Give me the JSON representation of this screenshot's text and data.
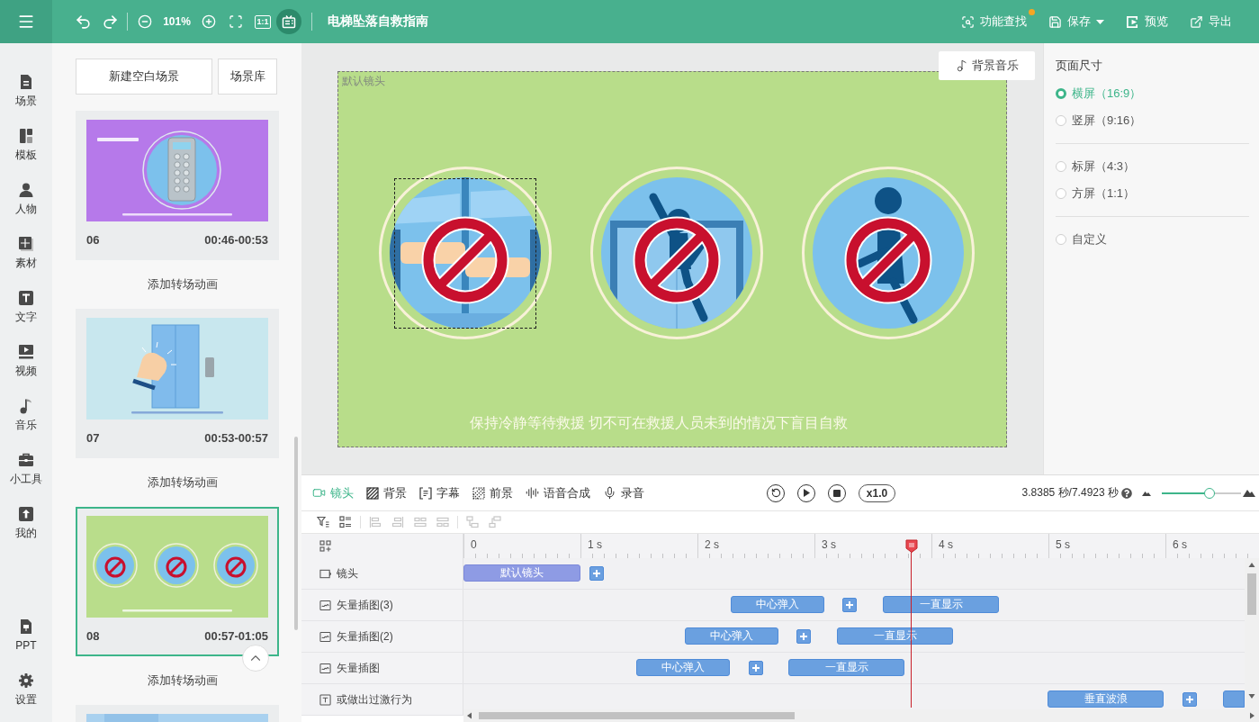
{
  "toolbar": {
    "zoom_level": "101%",
    "actual_size": "1:1",
    "captions_tool": {
      "selected": true
    },
    "title": "电梯坠落自救指南"
  },
  "toolbar_actions": [
    {
      "kind": "search",
      "label": "功能查找",
      "badge": true,
      "dropdown": false
    },
    {
      "kind": "save",
      "label": "保存",
      "badge": false,
      "dropdown": true
    },
    {
      "kind": "preview",
      "label": "预览",
      "badge": false,
      "dropdown": false
    },
    {
      "kind": "export",
      "label": "导出",
      "badge": false,
      "dropdown": false
    }
  ],
  "sidebar": {
    "items": [
      {
        "kind": "scene",
        "label": "场景"
      },
      {
        "kind": "template",
        "label": "模板"
      },
      {
        "kind": "person",
        "label": "人物"
      },
      {
        "kind": "material",
        "label": "素材"
      },
      {
        "kind": "text",
        "label": "文字"
      },
      {
        "kind": "video",
        "label": "视频"
      },
      {
        "kind": "music",
        "label": "音乐"
      },
      {
        "kind": "tools",
        "label": "小工具"
      },
      {
        "kind": "mine",
        "label": "我的"
      }
    ],
    "bottom_items": [
      {
        "kind": "ppt",
        "label": "PPT"
      },
      {
        "kind": "settings",
        "label": "设置"
      }
    ]
  },
  "scene_panel": {
    "buttons": [
      "新建空白场景",
      "场景库"
    ],
    "scenes": [
      {
        "kind": "keypad",
        "number": "06",
        "time": "00:46-00:53",
        "selected": false,
        "transition": "添加转场动画"
      },
      {
        "kind": "door",
        "number": "07",
        "time": "00:53-00:57",
        "selected": false,
        "transition": "添加转场动画"
      },
      {
        "kind": "signs",
        "number": "08",
        "time": "00:57-01:05",
        "selected": true,
        "transition": "添加转场动画"
      },
      {
        "kind": "blank",
        "selected": false
      }
    ]
  },
  "canvas": {
    "background_music": "背景音乐",
    "shot_label": "默认镜头",
    "illustrations": [
      {
        "kind": "hand",
        "selected": true
      },
      {
        "kind": "climber",
        "selected": false
      },
      {
        "kind": "jumper",
        "selected": false
      }
    ],
    "caption": "保持冷静等待救援 切不可在救援人员未到的情况下盲目自救"
  },
  "page_size": {
    "title": "页面尺寸",
    "groups": [
      {
        "options": [
          {
            "label": "横屏（16:9）",
            "selected": true
          },
          {
            "label": "竖屏（9:16）",
            "selected": false
          }
        ]
      },
      {
        "options": [
          {
            "label": "标屏（4:3）",
            "selected": false
          },
          {
            "label": "方屏（1:1）",
            "selected": false
          }
        ]
      },
      {
        "options": [
          {
            "label": "自定义",
            "selected": false
          }
        ]
      }
    ]
  },
  "timeline": {
    "tabs": [
      {
        "kind": "camera",
        "label": "镜头",
        "selected": true
      },
      {
        "kind": "background",
        "label": "背景",
        "selected": false
      },
      {
        "kind": "subtitle",
        "label": "字幕",
        "selected": false
      },
      {
        "kind": "foreground",
        "label": "前景",
        "selected": false
      },
      {
        "kind": "tts",
        "label": "语音合成",
        "selected": false
      },
      {
        "kind": "record",
        "label": "录音",
        "selected": false
      }
    ],
    "speed": "x1.0",
    "time": "3.8385 秒/7.4923 秒",
    "zoom": {
      "level": 0.6
    },
    "edit_tool_groups": [
      {
        "tools": [
          {
            "kind": "filter",
            "disabled": false
          },
          {
            "kind": "layers",
            "disabled": false
          }
        ]
      },
      {
        "tools": [
          {
            "kind": "align_left",
            "disabled": true
          },
          {
            "kind": "align_right",
            "disabled": true
          },
          {
            "kind": "distribute_left",
            "disabled": true
          },
          {
            "kind": "distribute_right",
            "disabled": true
          }
        ]
      },
      {
        "tools": [
          {
            "kind": "stack_down",
            "disabled": true
          },
          {
            "kind": "stack_up",
            "disabled": true
          }
        ]
      }
    ],
    "ruler": [
      "0",
      "1 s",
      "2 s",
      "3 s",
      "4 s",
      "5 s",
      "6 s"
    ],
    "playhead": {
      "level": 0.563
    },
    "tracks": [
      {
        "kind": "camera",
        "label": "镜头",
        "clips": [
          {
            "kind": "camera",
            "label": "默认镜头"
          },
          {
            "kind": "add"
          }
        ]
      },
      {
        "kind": "vector",
        "label": "矢量插图(3)",
        "clips": [
          {
            "kind": "effect",
            "label": "中心弹入"
          },
          {
            "kind": "add"
          },
          {
            "kind": "effect",
            "label": "一直显示"
          }
        ]
      },
      {
        "kind": "vector",
        "label": "矢量插图(2)",
        "clips": [
          {
            "kind": "effect",
            "label": "中心弹入"
          },
          {
            "kind": "add"
          },
          {
            "kind": "effect",
            "label": "一直显示"
          }
        ]
      },
      {
        "kind": "vector",
        "label": "矢量插图",
        "clips": [
          {
            "kind": "effect",
            "label": "中心弹入"
          },
          {
            "kind": "add"
          },
          {
            "kind": "effect",
            "label": "一直显示"
          }
        ]
      },
      {
        "kind": "text",
        "label": "或做出过激行为",
        "clips": [
          {
            "kind": "effect",
            "label": "垂直波浪"
          },
          {
            "kind": "add"
          },
          {
            "kind": "effect"
          }
        ]
      }
    ]
  }
}
